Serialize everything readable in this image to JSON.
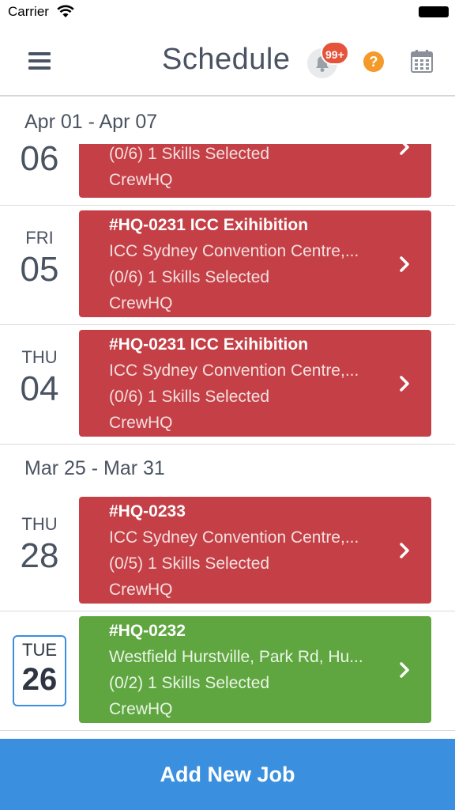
{
  "status": {
    "carrier": "Carrier"
  },
  "header": {
    "title": "Schedule",
    "notifications_badge": "99+",
    "help_label": "?"
  },
  "colors": {
    "accent": "#3a8fde",
    "job_red": "#c44046",
    "job_green": "#5fa641",
    "badge": "#e5533a",
    "help": "#f39a2b"
  },
  "weeks": [
    {
      "range": "Apr 01 - Apr 07",
      "days": [
        {
          "dow": "",
          "day": "06",
          "job": {
            "title": "",
            "location": "",
            "skills": "(0/6) 1 Skills Selected",
            "company": "CrewHQ",
            "color": "red"
          }
        },
        {
          "dow": "FRI",
          "day": "05",
          "job": {
            "title": "#HQ-0231 ICC Exihibition",
            "location": "ICC Sydney Convention Centre,...",
            "skills": "(0/6) 1 Skills Selected",
            "company": "CrewHQ",
            "color": "red"
          }
        },
        {
          "dow": "THU",
          "day": "04",
          "job": {
            "title": "#HQ-0231 ICC Exihibition",
            "location": "ICC Sydney Convention Centre,...",
            "skills": "(0/6) 1 Skills Selected",
            "company": "CrewHQ",
            "color": "red"
          }
        }
      ]
    },
    {
      "range": "Mar 25 - Mar 31",
      "days": [
        {
          "dow": "THU",
          "day": "28",
          "job": {
            "title": "#HQ-0233",
            "location": "ICC Sydney Convention Centre,...",
            "skills": "(0/5) 1 Skills Selected",
            "company": "CrewHQ",
            "color": "red"
          }
        },
        {
          "dow": "TUE",
          "day": "26",
          "today": true,
          "job": {
            "title": "#HQ-0232",
            "location": "Westfield Hurstville, Park Rd, Hu...",
            "skills": "(0/2) 1 Skills Selected",
            "company": "CrewHQ",
            "color": "green"
          }
        }
      ]
    }
  ],
  "footer": {
    "add_job_label": "Add New Job"
  }
}
